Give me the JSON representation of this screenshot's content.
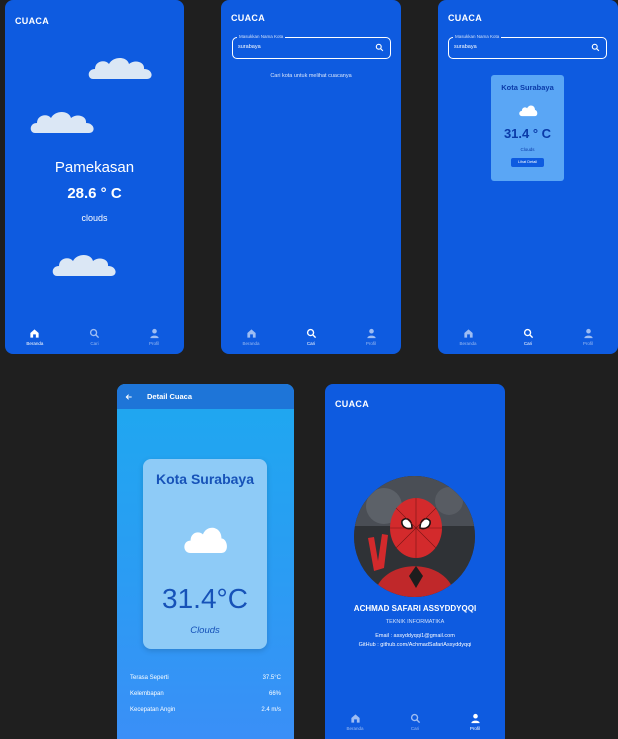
{
  "app_title": "CUACA",
  "nav": {
    "home": "Beranda",
    "search": "Cari",
    "profile": "Profil"
  },
  "home": {
    "city": "Pamekasan",
    "temp": "28.6 ° C",
    "desc": "clouds"
  },
  "search_empty": {
    "label": "Masukkan Nama Kota",
    "value": "surabaya",
    "hint": "Cari kota untuk melihat cuacanya"
  },
  "search_result": {
    "label": "Masukkan Nama Kota",
    "value": "surabaya",
    "card": {
      "city": "Kota Surabaya",
      "temp": "31.4 ° C",
      "desc": "Clouds",
      "button": "Lihat Detail"
    }
  },
  "detail": {
    "title": "Detail Cuaca",
    "city": "Kota Surabaya",
    "temp": "31.4°C",
    "desc": "Clouds",
    "rows": [
      {
        "label": "Terasa Seperti",
        "value": "37.5°C"
      },
      {
        "label": "Kelembapan",
        "value": "66%"
      },
      {
        "label": "Kecepatan Angin",
        "value": "2.4 m/s"
      }
    ]
  },
  "profile": {
    "name": "ACHMAD SAFARI ASSYDDYQQI",
    "major": "TEKNIK INFORMATIKA",
    "email": "Email : assyddyqqi1@gmail.com",
    "github": "GitHub : github.com/AchmadSafariAssyddyqqi"
  },
  "colors": {
    "primary_blue": "#0e5be0",
    "background": "#1f1f1f",
    "detail_gradient_top": "#1ea8f0",
    "detail_gradient_bottom": "#3a8ff7"
  }
}
